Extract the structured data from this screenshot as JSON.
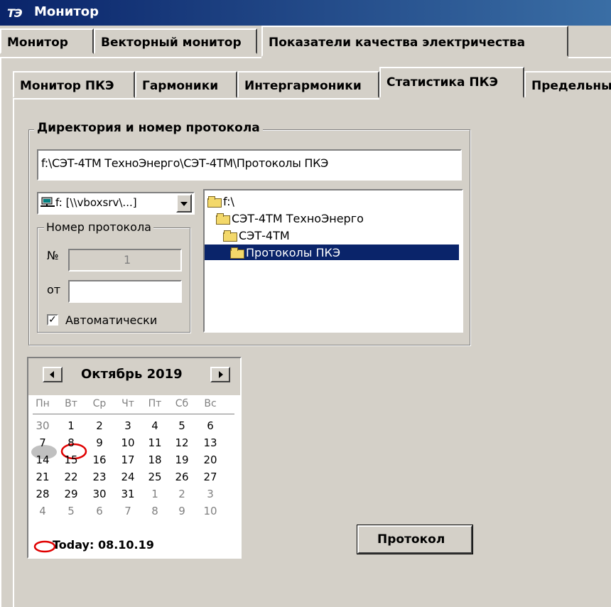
{
  "window": {
    "logo": "ТЭ",
    "title": "Монитор"
  },
  "main_tabs": [
    "Монитор",
    "Векторный монитор",
    "Показатели качества электричества"
  ],
  "sub_tabs": [
    "Монитор ПКЭ",
    "Гармоники",
    "Интергармоники",
    "Статистика ПКЭ",
    "Предельны"
  ],
  "protocol_group": {
    "legend": "Директория и номер протокола",
    "path_value": "f:\\СЭТ-4ТМ ТехноЭнерго\\СЭТ-4ТМ\\Протоколы ПКЭ",
    "drive_select": "f: [\\\\vboxsrv\\...]",
    "number_legend": "Номер протокола",
    "no_label": "№",
    "no_value": "1",
    "from_label": "от",
    "from_value": "",
    "auto_label": "Автоматически",
    "auto_checked": true,
    "tree": [
      "f:\\",
      "СЭТ-4ТМ ТехноЭнерго",
      "СЭТ-4ТМ",
      "Протоколы ПКЭ"
    ]
  },
  "calendar": {
    "month_title": "Октябрь 2019",
    "weekdays": [
      "Пн",
      "Вт",
      "Ср",
      "Чт",
      "Пт",
      "Сб",
      "Вс"
    ],
    "weeks": [
      [
        "30",
        "1",
        "2",
        "3",
        "4",
        "5",
        "6"
      ],
      [
        "7",
        "8",
        "9",
        "10",
        "11",
        "12",
        "13"
      ],
      [
        "14",
        "15",
        "16",
        "17",
        "18",
        "19",
        "20"
      ],
      [
        "21",
        "22",
        "23",
        "24",
        "25",
        "26",
        "27"
      ],
      [
        "28",
        "29",
        "30",
        "31",
        "1",
        "2",
        "3"
      ],
      [
        "4",
        "5",
        "6",
        "7",
        "8",
        "9",
        "10"
      ]
    ],
    "today_label": "Today: 08.10.19",
    "selected_day": "7",
    "today_day": "8"
  },
  "protocol_button": "Протокол"
}
